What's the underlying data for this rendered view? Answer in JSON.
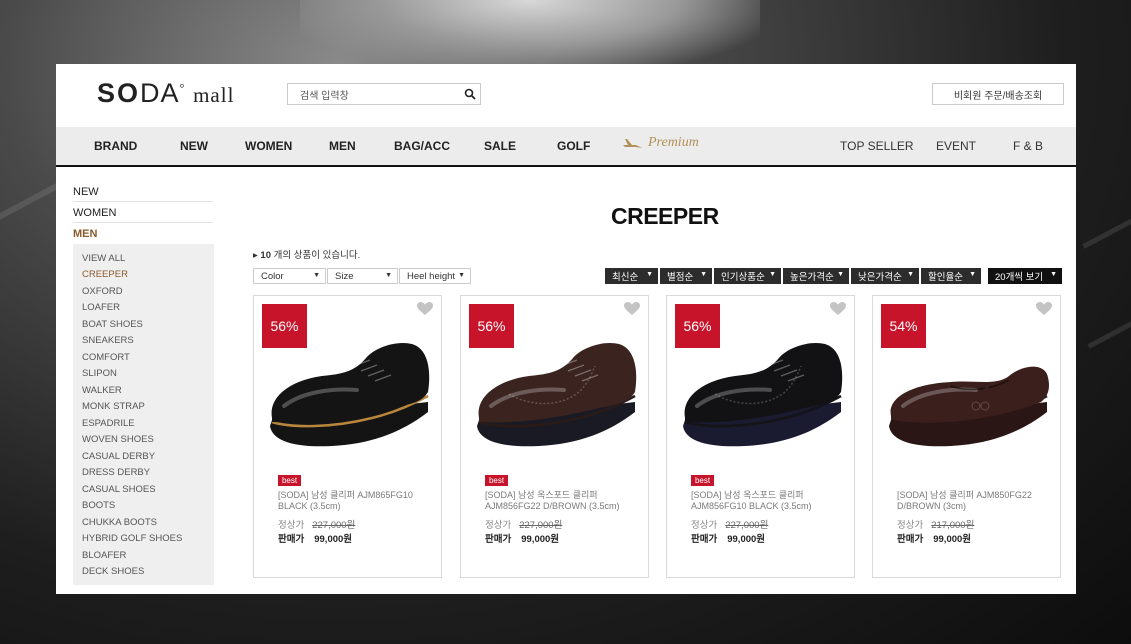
{
  "logo": {
    "bold": "SO",
    "thin": "DA",
    "mark": "°",
    "mall": "mall"
  },
  "search": {
    "placeholder": "검색 입력창"
  },
  "order_lookup": "비회원 주문/배송조회",
  "nav": [
    "BRAND",
    "NEW",
    "WOMEN",
    "MEN",
    "BAG/ACC",
    "SALE",
    "GOLF"
  ],
  "premium_label": "Premium",
  "nav_right": [
    "TOP SELLER",
    "EVENT",
    "F & B"
  ],
  "sidebar": {
    "top": [
      "NEW",
      "WOMEN",
      "MEN"
    ],
    "sub": [
      "VIEW ALL",
      "CREEPER",
      "OXFORD",
      "LOAFER",
      "BOAT SHOES",
      "SNEAKERS",
      "COMFORT",
      "SLIPON",
      "WALKER",
      "MONK STRAP",
      "ESPADRILE",
      "WOVEN SHOES",
      "CASUAL DERBY",
      "DRESS DERBY",
      "CASUAL SHOES",
      "BOOTS",
      "CHUKKA BOOTS",
      "HYBRID GOLF SHOES",
      "BLOAFER",
      "DECK SHOES"
    ],
    "active": "CREEPER"
  },
  "page_title": "CREEPER",
  "count": {
    "prefix": "▸",
    "number": "10",
    "suffix": " 개의 상품이 있습니다."
  },
  "filters": [
    "Color",
    "Size",
    "Heel height"
  ],
  "sorts": [
    "최신순",
    "별점순",
    "인기상품순",
    "높은가격순",
    "낮은가격순",
    "할인율순"
  ],
  "per_page": "20개씩 보기",
  "products": [
    {
      "discount": "56%",
      "badge": "best",
      "name": "[SODA] 남성 클리퍼 AJM865FG10 BLACK (3.5cm)",
      "list_label": "정상가",
      "list_price": "227,000원",
      "sale_label": "판매가",
      "sale_price": "99,000원",
      "color": "#141414",
      "sole": "#141414",
      "welt": "#b9863d",
      "style": "derby"
    },
    {
      "discount": "56%",
      "badge": "best",
      "name": "[SODA] 남성 옥스포드 클리퍼 AJM856FG22 D/BROWN (3.5cm)",
      "list_label": "정상가",
      "list_price": "227,000원",
      "sale_label": "판매가",
      "sale_price": "99,000원",
      "color": "#3b2420",
      "sole": "#1a1a24",
      "welt": "#2a1a18",
      "style": "wing"
    },
    {
      "discount": "56%",
      "badge": "best",
      "name": "[SODA] 남성 옥스포드 클리퍼 AJM856FG10 BLACK (3.5cm)",
      "list_label": "정상가",
      "list_price": "227,000원",
      "sale_label": "판매가",
      "sale_price": "99,000원",
      "color": "#121215",
      "sole": "#1a1a30",
      "welt": "#141418",
      "style": "wing"
    },
    {
      "discount": "54%",
      "badge": "",
      "name": "[SODA] 남성 클리퍼 AJM850FG22 D/BROWN (3cm)",
      "list_label": "정상가",
      "list_price": "217,000원",
      "sale_label": "판매가",
      "sale_price": "99,000원",
      "color": "#3a1f1c",
      "sole": "#2a1614",
      "welt": "#2a1614",
      "style": "loafer"
    }
  ]
}
